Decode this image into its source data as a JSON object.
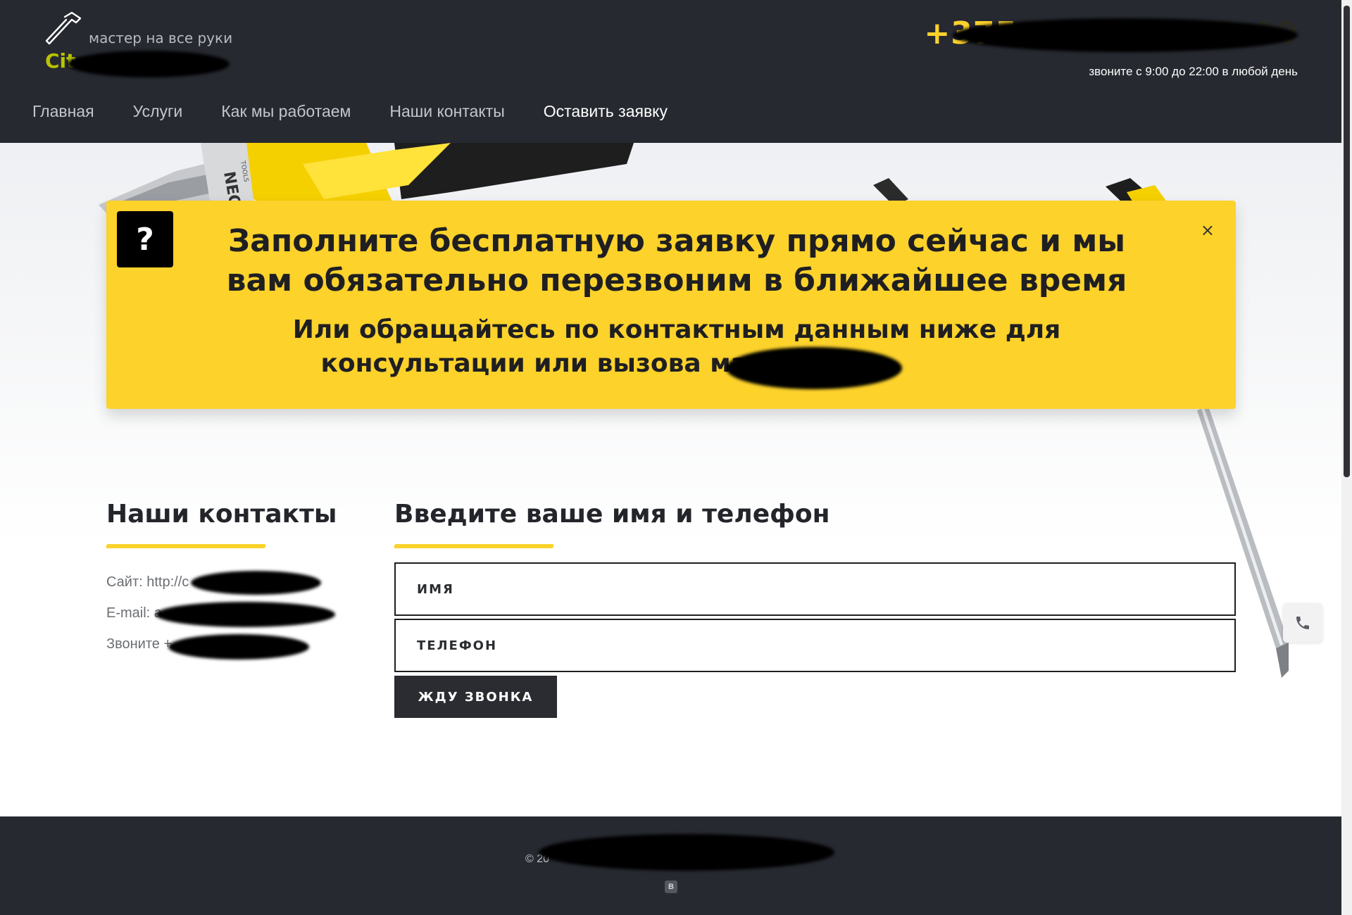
{
  "header": {
    "logo_tagline": "мастер на все руки",
    "logo_word": "Cit",
    "phone_prefix": "+375",
    "work_hours": "звоните с 9:00 до 22:00 в любой день"
  },
  "nav": {
    "items": [
      {
        "label": "Главная"
      },
      {
        "label": "Услуги"
      },
      {
        "label": "Как мы работаем"
      },
      {
        "label": "Наши контакты"
      },
      {
        "label": "Оставить заявку"
      }
    ]
  },
  "hero": {
    "tool_brand": "NEO",
    "tool_brand_sub": "TOOLS"
  },
  "banner": {
    "icon_glyph": "?",
    "close_glyph": "×",
    "title": "Заполните бесплатную заявку прямо сейчас и мы вам обязательно перезвоним в ближайшее время",
    "subtitle": "Или обращайтесь по контактным данным ниже для консультации или вызова мастера в"
  },
  "contacts": {
    "title": "Наши контакты",
    "site_label": "Сайт: http://c",
    "email_label": "E-mail: a",
    "call_label": "Звоните +"
  },
  "form": {
    "title": "Введите ваше имя и телефон",
    "name_placeholder": "имя",
    "phone_placeholder": "телефон",
    "submit_label": "ЖДУ ЗВОНКА"
  },
  "footer": {
    "copyright": "© 20",
    "vk_badge": "В"
  },
  "colors": {
    "accent_yellow": "#fcd22b",
    "header_bg": "#272931",
    "button_bg": "#2b2c31"
  }
}
